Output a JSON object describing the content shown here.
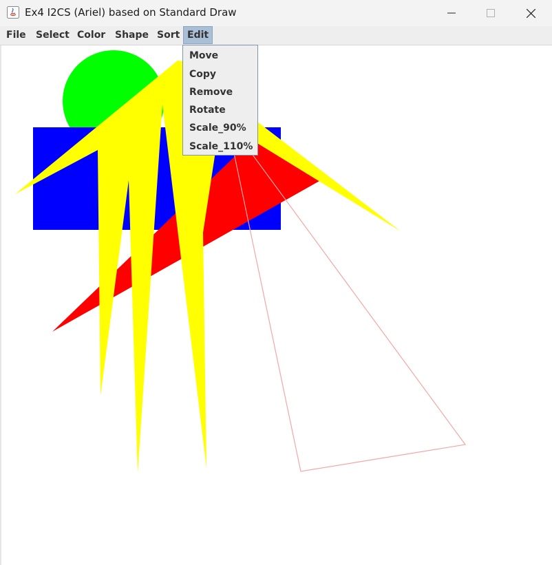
{
  "window": {
    "title": "Ex4 I2CS (Ariel) based on Standard Draw"
  },
  "menubar": {
    "items": [
      {
        "label": "File"
      },
      {
        "label": "Select"
      },
      {
        "label": "Color"
      },
      {
        "label": "Shape"
      },
      {
        "label": "Sort"
      },
      {
        "label": "Edit",
        "active": true
      }
    ]
  },
  "edit_menu": {
    "items": [
      {
        "label": "Move"
      },
      {
        "label": "Copy"
      },
      {
        "label": "Remove"
      },
      {
        "label": "Rotate"
      },
      {
        "label": "Scale_90%"
      },
      {
        "label": "Scale_110%"
      }
    ]
  },
  "canvas": {
    "colors": {
      "circle": "#00ff00",
      "rectangle": "#0000ff",
      "triangle": "#ff0000",
      "polygon": "#ffff00",
      "outline": "#f4a6a6"
    },
    "shapes": [
      "circle",
      "rectangle",
      "triangle",
      "polygon",
      "outline-quadrilateral"
    ]
  },
  "icons": [
    "java-app-icon",
    "minimize-icon",
    "maximize-icon",
    "close-icon"
  ]
}
